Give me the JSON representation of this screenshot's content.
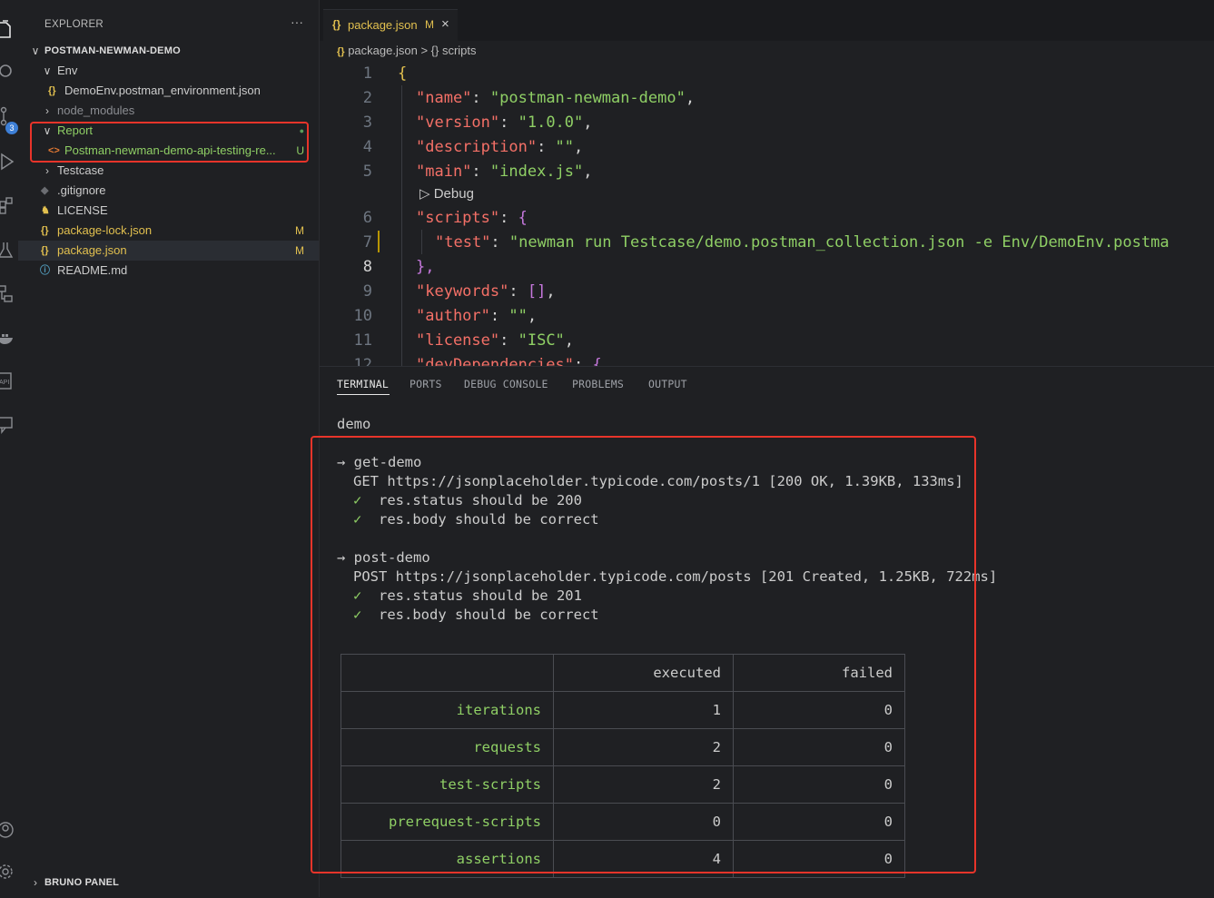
{
  "sidebar": {
    "title": "EXPLORER",
    "more": "···",
    "project": "POSTMAN-NEWMAN-DEMO",
    "bottom_section": "BRUNO PANEL",
    "source_control_badge": "3",
    "tree": [
      {
        "label": "Env",
        "chevron": "v",
        "color": "#cccccc"
      },
      {
        "label": "DemoEnv.postman_environment.json",
        "icon": "{}",
        "color": "#cccccc"
      },
      {
        "label": "node_modules",
        "chevron": ">",
        "color": "#8b8d92"
      },
      {
        "label": "Report",
        "chevron": "v",
        "color": "#8fcf65",
        "decoration": "●"
      },
      {
        "label": "Postman-newman-demo-api-testing-re...",
        "icon": "<>",
        "color": "#8fcf65",
        "decoration": "U"
      },
      {
        "label": "Testcase",
        "chevron": ">",
        "color": "#cccccc"
      },
      {
        "label": ".gitignore",
        "icon": "◆",
        "color": "#cccccc"
      },
      {
        "label": "LICENSE",
        "icon": "♞",
        "color": "#cccccc"
      },
      {
        "label": "package-lock.json",
        "icon": "{}",
        "color": "#e2c04f",
        "decoration": "M"
      },
      {
        "label": "package.json",
        "icon": "{}",
        "color": "#e2c04f",
        "decoration": "M"
      },
      {
        "label": "README.md",
        "icon": "ⓘ",
        "color": "#cccccc"
      }
    ]
  },
  "editor": {
    "tab": {
      "icon": "{}",
      "name": "package.json",
      "status": "M",
      "close": "×"
    },
    "breadcrumb": {
      "file_icon": "{}",
      "file": "package.json",
      "sep": ">",
      "sym_icon": "{}",
      "symbol": "scripts"
    },
    "debug_lens": "▷ Debug",
    "line_numbers": [
      "1",
      "2",
      "3",
      "4",
      "5",
      "6",
      "7",
      "8",
      "9",
      "10",
      "11",
      "12"
    ],
    "code": {
      "l1": "{",
      "l2k": "\"name\"",
      "l2v": "\"postman-newman-demo\"",
      "l3k": "\"version\"",
      "l3v": "\"1.0.0\"",
      "l4k": "\"description\"",
      "l4v": "\"\"",
      "l5k": "\"main\"",
      "l5v": "\"index.js\"",
      "l6k": "\"scripts\"",
      "l6v": "{",
      "l7k": "\"test\"",
      "l7v": "\"newman run Testcase/demo.postman_collection.json -e Env/DemoEnv.postma",
      "l8": "},",
      "l9k": "\"keywords\"",
      "l9v": "[]",
      "l10k": "\"author\"",
      "l10v": "\"\"",
      "l11k": "\"license\"",
      "l11v": "\"ISC\"",
      "l12k": "\"devDependencies\"",
      "l12v": "{"
    }
  },
  "panel": {
    "tabs": [
      "TERMINAL",
      "PORTS",
      "DEBUG CONSOLE",
      "PROBLEMS",
      "OUTPUT"
    ],
    "terminal": {
      "collection": "demo",
      "req1_name": "→ get-demo",
      "req1_line": "GET https://jsonplaceholder.typicode.com/posts/1 [200 OK, 1.39KB, 133ms]",
      "req1_t1": "res.status should be 200",
      "req1_t2": "res.body should be correct",
      "req2_name": "→ post-demo",
      "req2_line": "POST https://jsonplaceholder.typicode.com/posts [201 Created, 1.25KB, 722ms]",
      "req2_t1": "res.status should be 201",
      "req2_t2": "res.body should be correct",
      "check": "✓",
      "summary": {
        "headers": [
          "",
          "executed",
          "failed"
        ],
        "rows": [
          [
            "iterations",
            "1",
            "0"
          ],
          [
            "requests",
            "2",
            "0"
          ],
          [
            "test-scripts",
            "2",
            "0"
          ],
          [
            "prerequest-scripts",
            "0",
            "0"
          ],
          [
            "assertions",
            "4",
            "0"
          ]
        ]
      }
    }
  }
}
